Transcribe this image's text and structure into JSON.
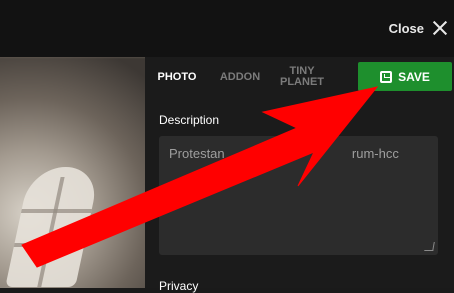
{
  "header": {
    "close_label": "Close"
  },
  "tabs": {
    "photo": "PHOTO",
    "addon": "ADDON",
    "tiny_planet": "TINY PLANET"
  },
  "save_label": "SAVE",
  "description": {
    "label": "Description",
    "value_start": "Protestan",
    "value_end": "rum-hcc"
  },
  "privacy_label": "Privacy",
  "colors": {
    "save": "#1e8f2d",
    "arrow": "#ff0000"
  },
  "icons": [
    "close-icon",
    "save-icon",
    "resize-grip-icon",
    "red-arrow"
  ]
}
